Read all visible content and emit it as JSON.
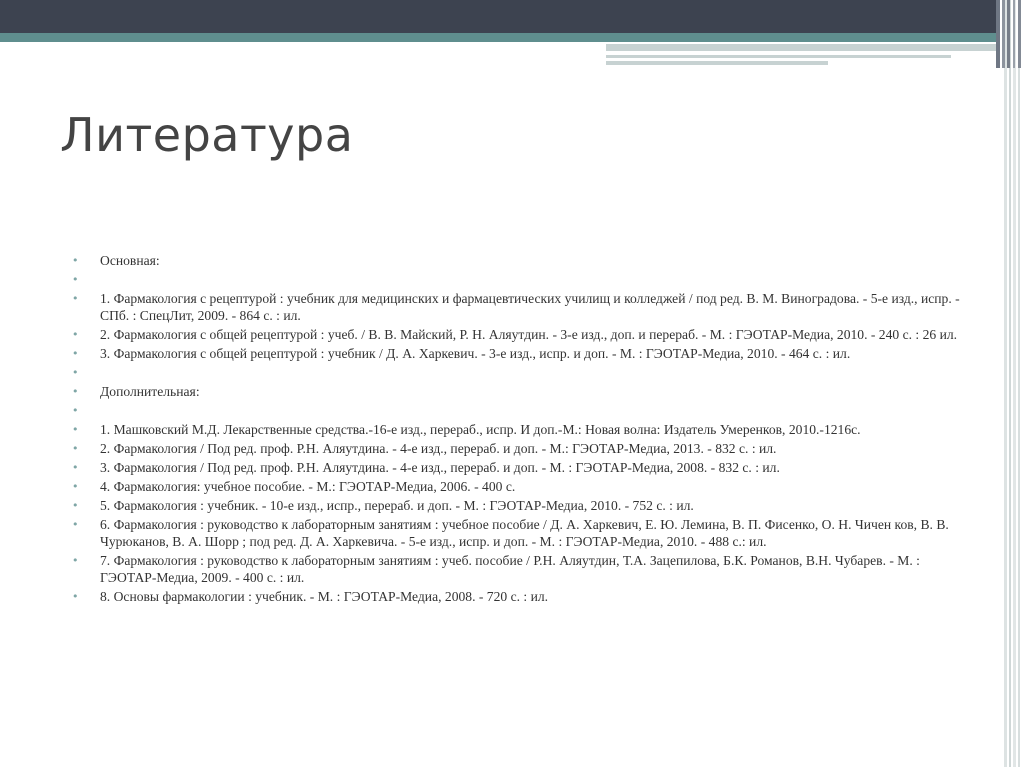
{
  "slide": {
    "title": "Литература",
    "items": [
      "Основная:",
      "",
      "1. Фармакология с рецептурой : учебник для медицинских и фармацевтических училищ и колледжей / под ред. В. М. Виноградова. - 5-е изд., испр. - СПб. : СпецЛит, 2009. - 864 с. : ил.",
      "2. Фармакология с общей рецептурой : учеб. / В. В. Майский, Р. Н. Аляутдин. - 3-е изд., доп. и перераб. - М. : ГЭОТАР-Медиа, 2010. - 240 с. : 26 ил.",
      "3. Фармакология с общей рецептурой : учебник / Д. А. Харкевич. - 3-е изд., испр. и доп. - М. : ГЭОТАР-Медиа, 2010. - 464 с. : ил.",
      "",
      "Дополнительная:",
      "",
      "1. Машковский М.Д. Лекарственные средства.-16-е изд., перераб., испр. И доп.-М.: Новая волна: Издатель Умеренков, 2010.-1216с.",
      "2. Фармакология / Под ред. проф. Р.Н. Аляутдина. - 4-е изд., перераб. и доп. - М.: ГЭОТАР-Медиа, 2013. - 832 с. : ил.",
      "3. Фармакология / Под ред. проф. Р.Н. Аляутдина. - 4-е изд., перераб. и доп. - М. : ГЭОТАР-Медиа, 2008. - 832 с. : ил.",
      "4. Фармакология: учебное пособие. - М.: ГЭОТАР-Медиа, 2006. - 400 с.",
      "5. Фармакология : учебник. - 10-е изд., испр., перераб. и доп. - М. : ГЭОТАР-Медиа, 2010. - 752 с. : ил.",
      "6. Фармакология : руководство к лабораторным занятиям : учебное пособие / Д. А. Харкевич, Е. Ю. Лемина, В. П. Фисенко, О. Н. Чичен ков, В. В. Чурюканов, В. А. Шорр ; под ред. Д. А. Харкевича. - 5-е изд., испр. и доп. - М. : ГЭОТАР-Медиа, 2010. - 488 с.: ил.",
      "7. Фармакология : руководство к лабораторным занятиям : учеб. пособие / Р.Н. Аляутдин, Т.А. Зацепилова, Б.К. Романов, В.Н. Чубарев. - М. : ГЭОТАР-Медиа, 2009. - 400 с. : ил.",
      "8. Основы фармакологии : учебник. - М. : ГЭОТАР-Медиа, 2008. - 720 с. : ил."
    ]
  },
  "colors": {
    "topbar": "#3d4350",
    "accent": "#5f8e8e",
    "bullet": "#7fa6a6"
  }
}
